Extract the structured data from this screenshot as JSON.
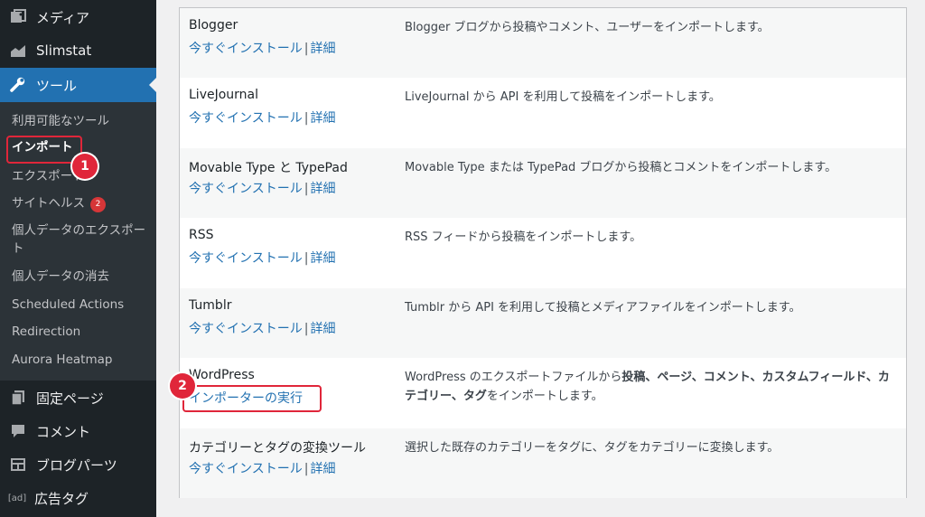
{
  "sidebar": {
    "menu": [
      {
        "label": "メディア",
        "icon": "media-icon"
      },
      {
        "label": "Slimstat",
        "icon": "chart-icon"
      },
      {
        "label": "ツール",
        "icon": "wrench-icon"
      },
      {
        "label": "固定ページ",
        "icon": "page-icon"
      },
      {
        "label": "コメント",
        "icon": "comment-icon"
      },
      {
        "label": "ブログパーツ",
        "icon": "widget-icon"
      },
      {
        "label": "広告タグ",
        "icon": "ad-icon",
        "icon_text": "[ad]"
      }
    ],
    "submenu": [
      {
        "label": "利用可能なツール"
      },
      {
        "label": "インポート"
      },
      {
        "label": "エクスポート"
      },
      {
        "label": "サイトヘルス",
        "badge": "2"
      },
      {
        "label": "個人データのエクスポート"
      },
      {
        "label": "個人データの消去"
      },
      {
        "label": "Scheduled Actions"
      },
      {
        "label": "Redirection"
      },
      {
        "label": "Aurora Heatmap"
      }
    ]
  },
  "importers": [
    {
      "name": "Blogger",
      "install": "今すぐインストール",
      "sep": "|",
      "details": "詳細",
      "desc": "Blogger ブログから投稿やコメント、ユーザーをインポートします。"
    },
    {
      "name": "LiveJournal",
      "install": "今すぐインストール",
      "sep": "|",
      "details": "詳細",
      "desc": "LiveJournal から API を利用して投稿をインポートします。"
    },
    {
      "name": "Movable Type と TypePad",
      "install": "今すぐインストール",
      "sep": "|",
      "details": "詳細",
      "desc": "Movable Type または TypePad ブログから投稿とコメントをインポートします。"
    },
    {
      "name": "RSS",
      "install": "今すぐインストール",
      "sep": "|",
      "details": "詳細",
      "desc": "RSS フィードから投稿をインポートします。"
    },
    {
      "name": "Tumblr",
      "install": "今すぐインストール",
      "sep": "|",
      "details": "詳細",
      "desc": "Tumblr から API を利用して投稿とメディアファイルをインポートします。"
    },
    {
      "name": "WordPress",
      "run": "インポーターの実行",
      "desc_parts": [
        "WordPress のエクスポートファイルから",
        "投稿、ページ、コメント、カスタムフィールド、カテゴリー、タグ",
        "をインポートします。"
      ]
    },
    {
      "name": "カテゴリーとタグの変換ツール",
      "install": "今すぐインストール",
      "sep": "|",
      "details": "詳細",
      "desc": "選択した既存のカテゴリーをタグに、タグをカテゴリーに変換します。"
    }
  ],
  "annotations": {
    "step1": "1",
    "step2": "2"
  },
  "colors": {
    "sidebar_bg": "#1d2327",
    "submenu_bg": "#2c3338",
    "active_bg": "#2271b1",
    "link": "#2271b1",
    "annotation_red": "#e0263a"
  }
}
